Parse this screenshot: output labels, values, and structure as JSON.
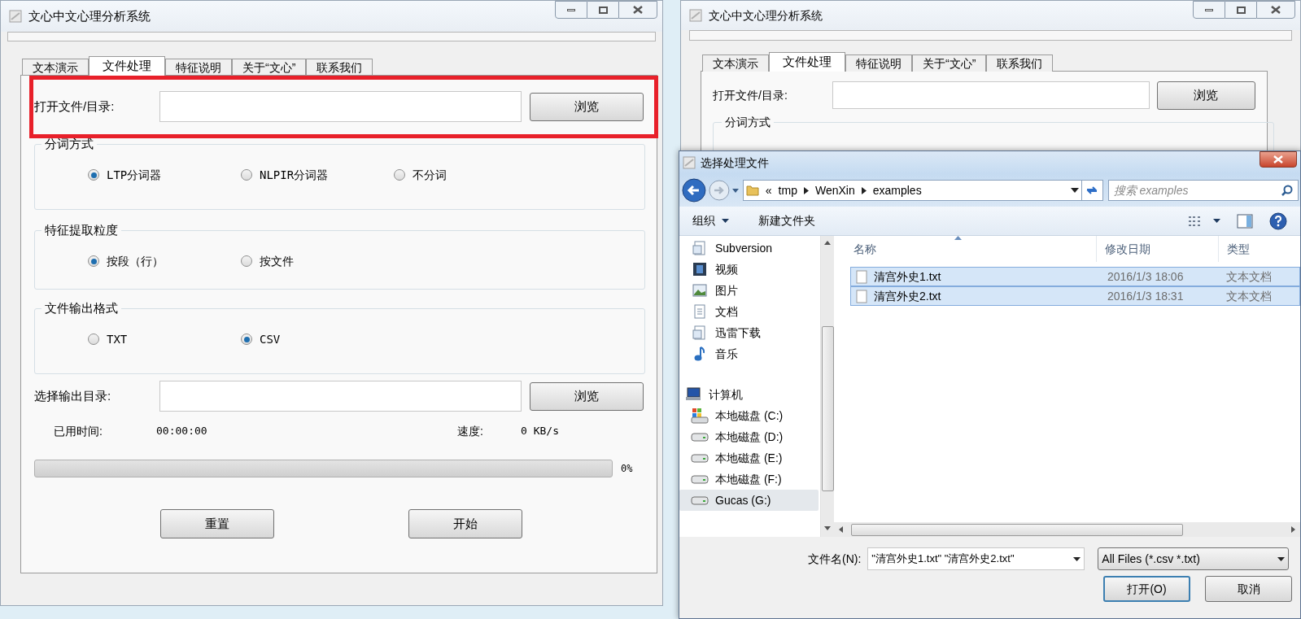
{
  "main_window": {
    "title": "文心中文心理分析系统",
    "tabs": [
      {
        "label": "文本演示",
        "selected": false
      },
      {
        "label": "文件处理",
        "selected": true
      },
      {
        "label": "特征说明",
        "selected": false
      },
      {
        "label": "关于“文心”",
        "selected": false
      },
      {
        "label": "联系我们",
        "selected": false
      }
    ],
    "open_label": "打开文件/目录:",
    "open_button": "浏览",
    "groups": [
      {
        "title": "分词方式",
        "options": [
          {
            "label": "LTP分词器",
            "selected": true
          },
          {
            "label": "NLPIR分词器",
            "selected": false
          },
          {
            "label": "不分词",
            "selected": false
          }
        ]
      },
      {
        "title": "特征提取粒度",
        "options": [
          {
            "label": "按段（行）",
            "selected": true
          },
          {
            "label": "按文件",
            "selected": false
          }
        ]
      },
      {
        "title": "文件输出格式",
        "options": [
          {
            "label": "TXT",
            "selected": false
          },
          {
            "label": "CSV",
            "selected": true
          }
        ]
      }
    ],
    "output_label": "选择输出目录:",
    "output_button": "浏览",
    "elapsed_label": "已用时间:",
    "elapsed_value": "00:00:00",
    "speed_label": "速度:",
    "speed_value": "0 KB/s",
    "progress": {
      "level": 0,
      "reading": "0%"
    },
    "buttons": [
      "重置",
      "开始"
    ]
  },
  "background_window": {
    "title": "文心中文心理分析系统",
    "tabs": [
      {
        "label": "文本演示",
        "selected": false
      },
      {
        "label": "文件处理",
        "selected": true
      },
      {
        "label": "特征说明",
        "selected": false
      },
      {
        "label": "关于“文心”",
        "selected": false
      },
      {
        "label": "联系我们",
        "selected": false
      }
    ],
    "open_label": "打开文件/目录:",
    "open_button": "浏览",
    "group_title": "分词方式"
  },
  "dialog": {
    "title": "选择处理文件",
    "path_prefix": "«",
    "path": [
      "tmp",
      "WenXin",
      "examples"
    ],
    "search_placeholder": "搜索 examples",
    "toolbar": [
      "组织",
      "新建文件夹"
    ],
    "nav": [
      {
        "label": "Subversion",
        "kind": "library",
        "selected": false
      },
      {
        "label": "视频",
        "kind": "video",
        "selected": false
      },
      {
        "label": "图片",
        "kind": "picture",
        "selected": false
      },
      {
        "label": "文档",
        "kind": "document",
        "selected": false
      },
      {
        "label": "迅雷下载",
        "kind": "library",
        "selected": false
      },
      {
        "label": "音乐",
        "kind": "music",
        "selected": false
      },
      {
        "label": "计算机",
        "kind": "computer",
        "selected": false,
        "children": [
          {
            "label": "本地磁盘 (C:)",
            "kind": "system-drive",
            "selected": false
          },
          {
            "label": "本地磁盘 (D:)",
            "kind": "drive",
            "selected": false
          },
          {
            "label": "本地磁盘 (E:)",
            "kind": "drive",
            "selected": false
          },
          {
            "label": "本地磁盘 (F:)",
            "kind": "drive",
            "selected": false
          },
          {
            "label": "Gucas (G:)",
            "kind": "drive",
            "selected": true
          }
        ]
      }
    ],
    "columns": [
      "名称",
      "修改日期",
      "类型"
    ],
    "files": [
      {
        "name": "清宫外史1.txt",
        "date": "2016/1/3 18:06",
        "type": "文本文档",
        "selected": true
      },
      {
        "name": "清宫外史2.txt",
        "date": "2016/1/3 18:31",
        "type": "文本文档",
        "selected": true
      }
    ],
    "filename_label": "文件名(N):",
    "filename_value": "\"清宫外史1.txt\" \"清宫外史2.txt\"",
    "filter": "All Files (*.csv *.txt)",
    "buttons": [
      "打开(O)",
      "取消"
    ]
  }
}
